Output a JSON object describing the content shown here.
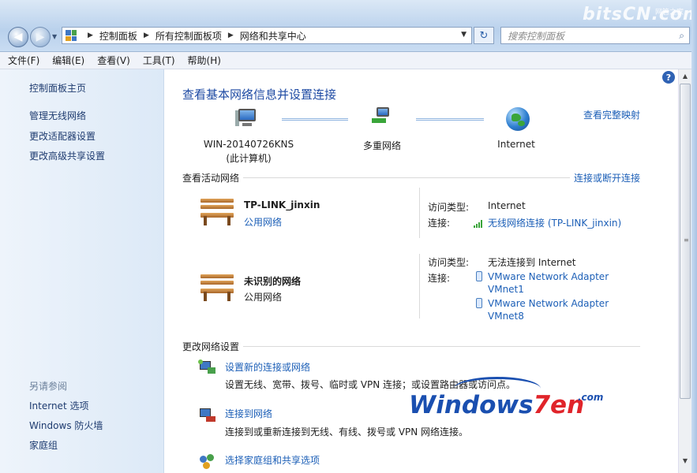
{
  "window": {
    "address_parts": [
      "控制面板",
      "所有控制面板项",
      "网络和共享中心"
    ],
    "search_placeholder": "搜索控制面板",
    "watermark_top": "bitsCN.com",
    "watermark_top_sub": "网管之家"
  },
  "menu": [
    "文件(F)",
    "编辑(E)",
    "查看(V)",
    "工具(T)",
    "帮助(H)"
  ],
  "sidebar": {
    "links": [
      "控制面板主页",
      "管理无线网络",
      "更改适配器设置",
      "更改高级共享设置"
    ],
    "see_also_title": "另请参阅",
    "see_also": [
      "Internet 选项",
      "Windows 防火墙",
      "家庭组"
    ]
  },
  "main": {
    "title": "查看基本网络信息并设置连接",
    "full_map_link": "查看完整映射",
    "map": {
      "computer_name": "WIN-20140726KNS",
      "computer_sub": "(此计算机)",
      "middle": "多重网络",
      "internet": "Internet"
    },
    "active_networks_title": "查看活动网络",
    "connect_disconnect_link": "连接或断开连接",
    "networks": [
      {
        "name": "TP-LINK_jinxin",
        "type": "公用网络",
        "access_label": "访问类型:",
        "access_value": "Internet",
        "conn_label": "连接:",
        "conn_value": "无线网络连接 (TP-LINK_jinxin)"
      },
      {
        "name": "未识别的网络",
        "type": "公用网络",
        "access_label": "访问类型:",
        "access_value": "无法连接到 Internet",
        "conn_label": "连接:",
        "conn_value_1a": "VMware Network Adapter",
        "conn_value_1b": "VMnet1",
        "conn_value_2a": "VMware Network Adapter",
        "conn_value_2b": "VMnet8"
      }
    ],
    "change_settings_title": "更改网络设置",
    "tasks": [
      {
        "link": "设置新的连接或网络",
        "desc": "设置无线、宽带、拨号、临时或 VPN 连接；或设置路由器或访问点。"
      },
      {
        "link": "连接到网络",
        "desc": "连接到或重新连接到无线、有线、拨号或 VPN 网络连接。"
      },
      {
        "link": "选择家庭组和共享选项"
      }
    ]
  },
  "watermark": {
    "text_a": "Windows",
    "text_b": "7en",
    "suffix": ".com"
  }
}
